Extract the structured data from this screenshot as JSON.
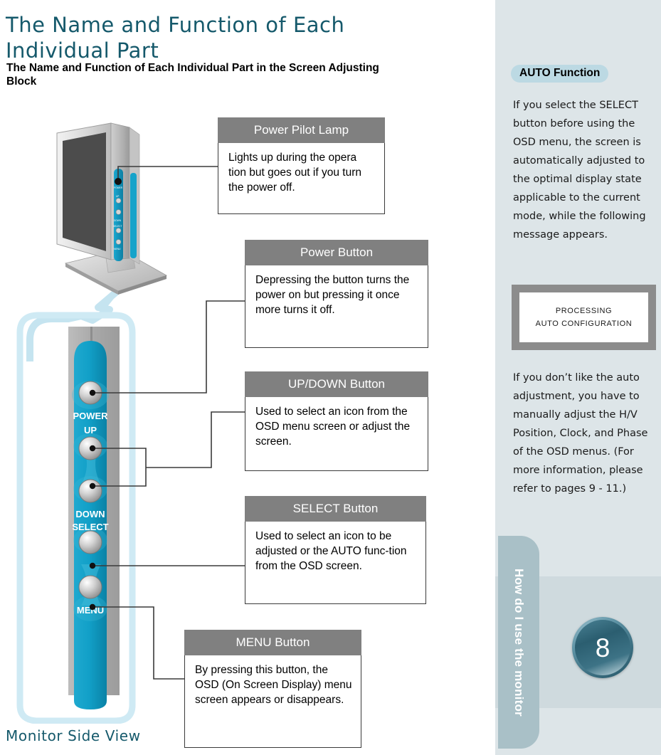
{
  "page": {
    "title": "The Name and Function of Each Individual Part",
    "subtitle": "The Name and Function of Each Individual Part in the Screen Adjusting Block",
    "side_view_label": "Monitor Side View",
    "number": "8",
    "chapter_tab": "How do I use the monitor"
  },
  "callouts": [
    {
      "key": "pilot",
      "title": "Power Pilot Lamp",
      "body": "Lights up during the opera tion but goes out if you turn the power off."
    },
    {
      "key": "power",
      "title": "Power Button",
      "body": "Depressing the button turns the power on  but pressing it once more turns  it off."
    },
    {
      "key": "updown",
      "title": "UP/DOWN Button",
      "body": "Used to select an icon from the OSD menu screen or adjust the screen."
    },
    {
      "key": "select",
      "title": "SELECT Button",
      "body": "Used to select  an icon  to be adjusted  or the  AUTO func-tion from  the OSD screen."
    },
    {
      "key": "menu",
      "title": "MENU Button",
      "body": "By pressing this button, the OSD (On  Screen Display) menu screen appears or disappears."
    }
  ],
  "monitor_buttons": [
    {
      "label": "POWER"
    },
    {
      "label": "UP"
    },
    {
      "label": "DOWN"
    },
    {
      "label": "SELECT"
    },
    {
      "label": "MENU"
    }
  ],
  "sidebar": {
    "badge": "AUTO Function",
    "paragraph_1": "If you select  the SELECT button  before using  the OSD menu,  the screen is automatically adjusted  to the   optimal display state applicable  to the  current mode, while the following message appears.",
    "paragraph_2": "If you don’t  like the  auto adjustment, you  have to manually adjust the  H/V Position, Clock, and  Phase of  the OSD  menus. (For more information, please refer to pages 9 - 11.)",
    "osd_message": {
      "line1": "PROCESSING",
      "line2": "AUTO CONFIGURATION"
    }
  },
  "colors": {
    "title": "#15596b",
    "callout_header_bg": "#808080",
    "sidebar_bg": "#dde5e8",
    "sidebar_band": "#cfdade",
    "badge_bg": "#bcd9e3",
    "tab_bg": "#a9c0c7",
    "panel_blue": "#12a0c8",
    "osd_frame": "#8c8c8c"
  }
}
